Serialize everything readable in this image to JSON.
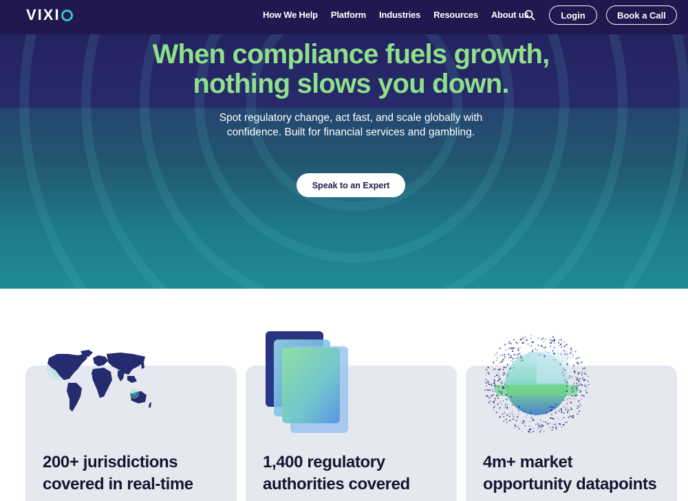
{
  "brand": {
    "logo_text": "VIXI"
  },
  "nav": {
    "links": [
      "How We Help",
      "Platform",
      "Industries",
      "Resources",
      "About us"
    ],
    "login_label": "Login",
    "book_call_label": "Book a Call",
    "search_icon": "search-icon"
  },
  "hero": {
    "headline_line1": "When compliance fuels growth,",
    "headline_line2": "nothing slows you down.",
    "subtext_line1": "Spot regulatory change, act fast, and scale globally with",
    "subtext_line2": "confidence. Built for financial services and gambling.",
    "cta_label": "Speak to an Expert"
  },
  "stats": [
    {
      "line1": "200+ jurisdictions",
      "line2": "covered in real-time",
      "illustration": "world-map-illustration"
    },
    {
      "line1": "1,400 regulatory",
      "line2": "authorities covered",
      "illustration": "stacked-documents-illustration"
    },
    {
      "line1": "4m+ market",
      "line2": "opportunity datapoints",
      "illustration": "data-sphere-illustration"
    }
  ],
  "colors": {
    "nav_bg": "#20184f",
    "headline_green": "#8ee08a",
    "teal_accent": "#36c8bd",
    "card_bg": "#e6e8ef",
    "text_dark": "#131730"
  }
}
